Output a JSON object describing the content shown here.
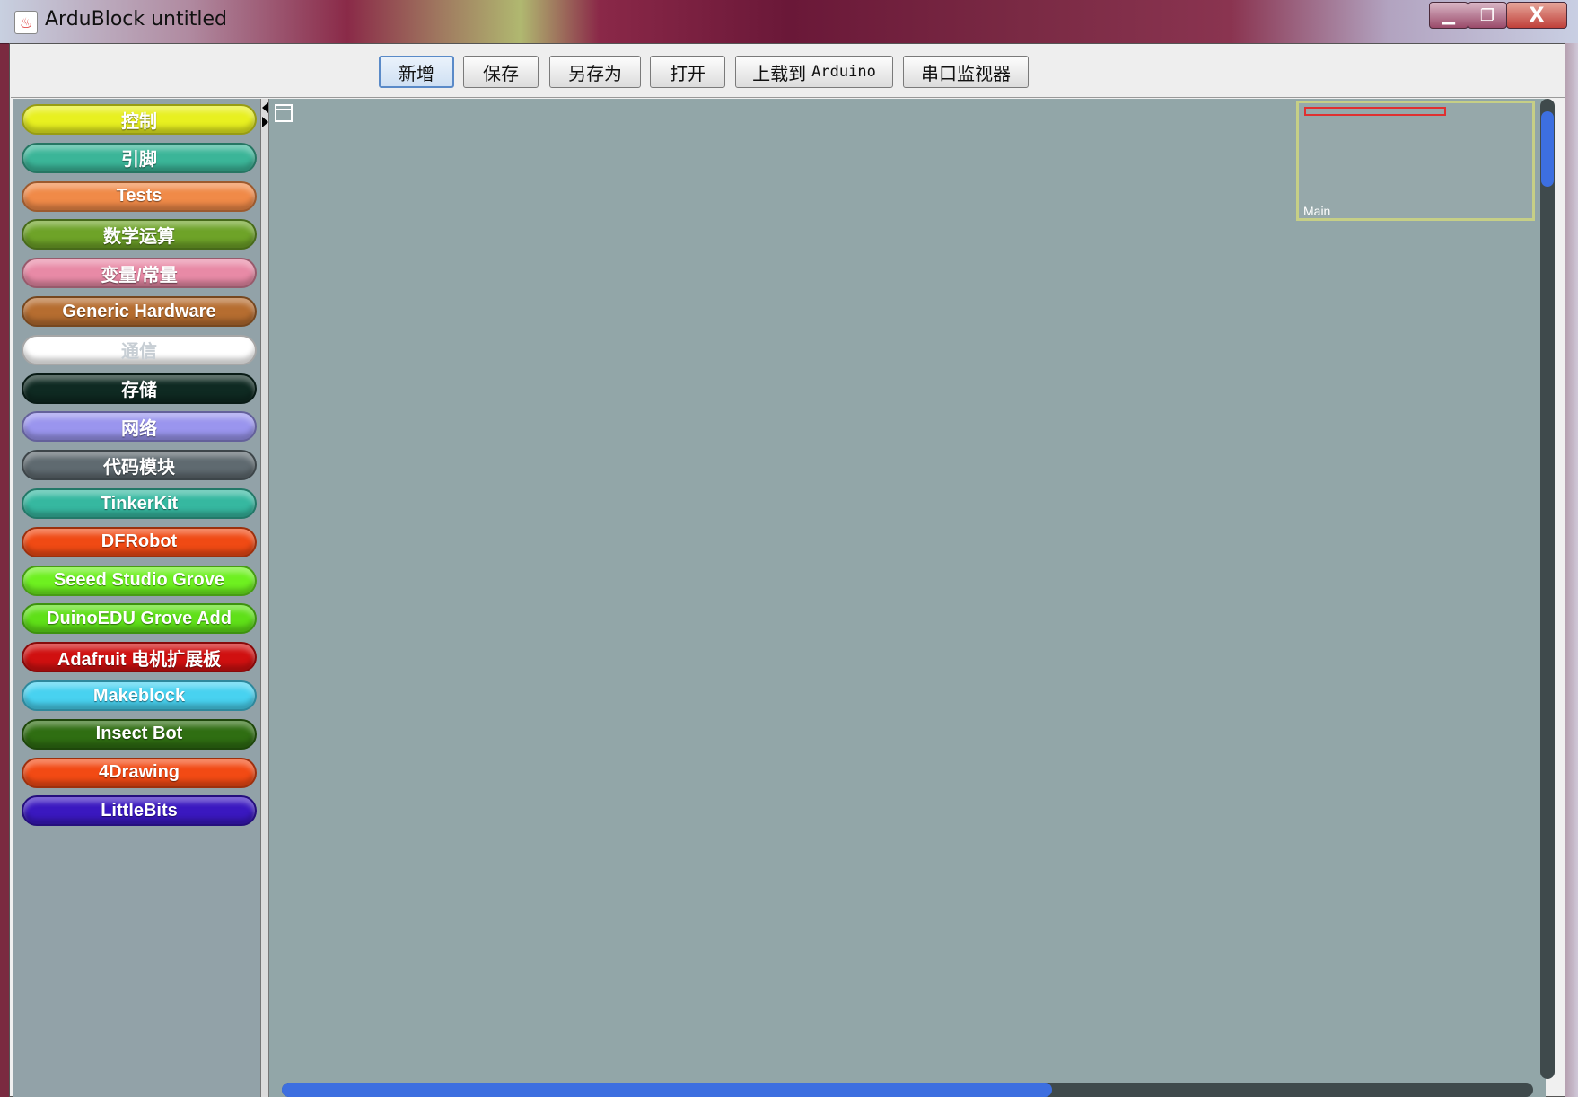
{
  "window": {
    "title": "ArduBlock untitled",
    "minimize": "▁",
    "maximize": "❐",
    "close": "X"
  },
  "toolbar": {
    "new_label": "新增",
    "save_label": "保存",
    "save_as_label": "另存为",
    "open_label": "打开",
    "upload_prefix": "上载到",
    "upload_suffix": "Arduino",
    "serial_label": "串口监视器"
  },
  "palette": {
    "categories": [
      {
        "label": "控制",
        "color": "#e8f020"
      },
      {
        "label": "引脚",
        "color": "#3bb598"
      },
      {
        "label": "Tests",
        "color": "#f08a48"
      },
      {
        "label": "数学运算",
        "color": "#6ea328"
      },
      {
        "label": "变量/常量",
        "color": "#e88aa6"
      },
      {
        "label": "Generic Hardware",
        "color": "#b66d30"
      },
      {
        "label": "通信",
        "color": "#ffffff"
      },
      {
        "label": "存储",
        "color": "#0f2a22"
      },
      {
        "label": "网络",
        "color": "#9a95ee"
      },
      {
        "label": "代码模块",
        "color": "#5f6a70"
      },
      {
        "label": "TinkerKit",
        "color": "#36b8a0"
      },
      {
        "label": "DFRobot",
        "color": "#f04a14"
      },
      {
        "label": "Seeed Studio Grove",
        "color": "#6ef020"
      },
      {
        "label": "DuinoEDU Grove Add",
        "color": "#5fe018"
      },
      {
        "label": "Adafruit 电机扩展板",
        "color": "#d01010"
      },
      {
        "label": "Makeblock",
        "color": "#48d2f0"
      },
      {
        "label": "Insect Bot",
        "color": "#2f6e12"
      },
      {
        "label": "4Drawing",
        "color": "#f24a14"
      },
      {
        "label": "LittleBits",
        "color": "#3a18c0"
      }
    ]
  },
  "canvas": {
    "minimap_label": "Main"
  }
}
